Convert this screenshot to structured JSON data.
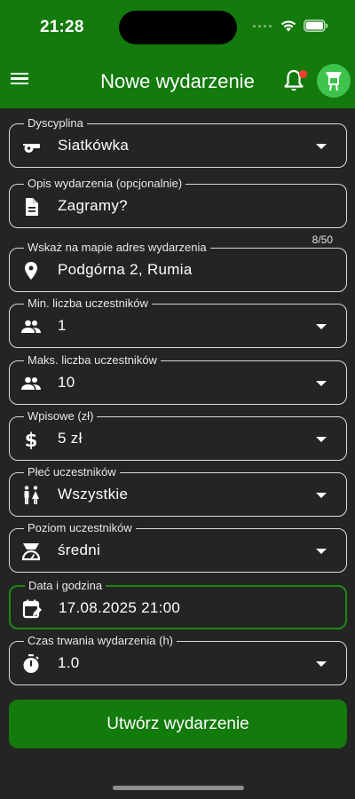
{
  "status_bar": {
    "time": "21:28"
  },
  "header": {
    "title": "Nowe wydarzenie"
  },
  "form": {
    "discipline": {
      "label": "Dyscyplina",
      "value": "Siatkówka"
    },
    "description": {
      "label": "Opis wydarzenia (opcjonalnie)",
      "value": "Zagramy?",
      "counter": "8/50"
    },
    "address": {
      "label": "Wskaż na mapie adres wydarzenia",
      "value": "Podgórna 2, Rumia"
    },
    "min_participants": {
      "label": "Min. liczba uczestników",
      "value": "1"
    },
    "max_participants": {
      "label": "Maks. liczba uczestników",
      "value": "10"
    },
    "fee": {
      "label": "Wpisowe (zł)",
      "value": "5 zł"
    },
    "gender": {
      "label": "Płeć uczestników",
      "value": "Wszystkie"
    },
    "level": {
      "label": "Poziom uczestników",
      "value": "średni"
    },
    "datetime": {
      "label": "Data i godzina",
      "value": "17.08.2025 21:00"
    },
    "duration": {
      "label": "Czas trwania wydarzenia (h)",
      "value": "1.0"
    }
  },
  "actions": {
    "submit_label": "Utwórz wydarzenie"
  },
  "colors": {
    "primary": "#137a0c",
    "background": "#242424",
    "accent_badge": "#ff3b30",
    "avatar": "#3ec44a"
  },
  "icons": [
    "menu-icon",
    "bell-icon",
    "avatar-icon",
    "whistle-icon",
    "document-icon",
    "location-pin-icon",
    "people-icon",
    "dollar-icon",
    "gender-icon",
    "scale-icon",
    "calendar-edit-icon",
    "stopwatch-icon"
  ]
}
